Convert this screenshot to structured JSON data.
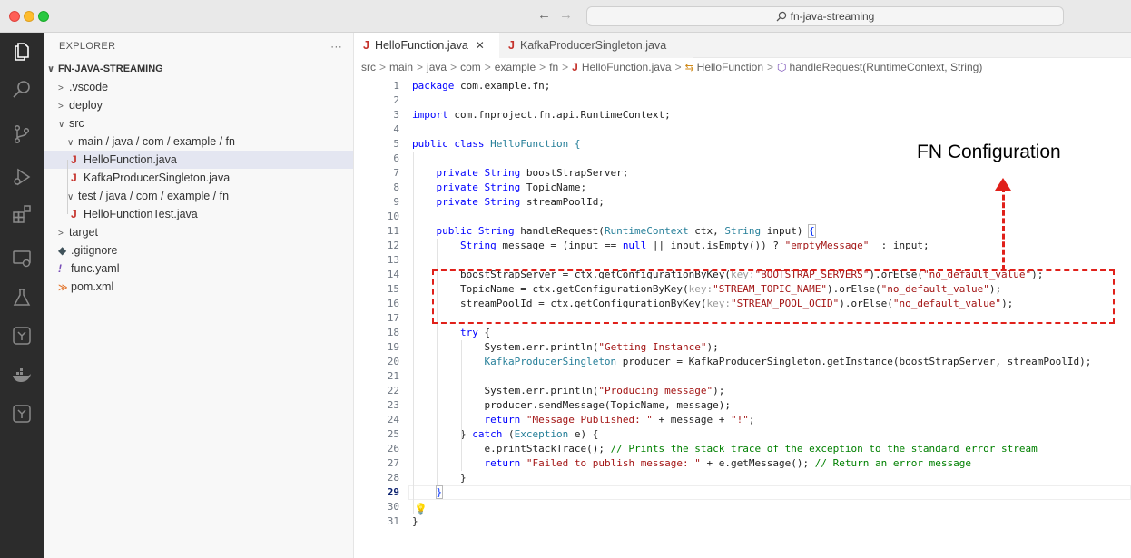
{
  "window": {
    "search_text": "fn-java-streaming"
  },
  "sidebar": {
    "header": "EXPLORER",
    "more": "···",
    "project": "FN-JAVA-STREAMING",
    "tree": {
      "vscode": ".vscode",
      "deploy": "deploy",
      "src": "src",
      "main_path": "main / java / com / example / fn",
      "hello_function": "HelloFunction.java",
      "kafka_producer": "KafkaProducerSingleton.java",
      "test_path": "test / java / com / example / fn",
      "hello_function_test": "HelloFunctionTest.java",
      "target": "target",
      "gitignore": ".gitignore",
      "func_yaml": "func.yaml",
      "pom_xml": "pom.xml"
    }
  },
  "editor": {
    "tabs": [
      {
        "label": "HelloFunction.java",
        "active": true
      },
      {
        "label": "KafkaProducerSingleton.java",
        "active": false
      }
    ],
    "breadcrumb": {
      "src": "src",
      "main": "main",
      "java": "java",
      "com": "com",
      "example": "example",
      "fn": "fn",
      "file": "HelloFunction.java",
      "class": "HelloFunction",
      "method": "handleRequest(RuntimeContext, String)"
    },
    "current_line": 29
  },
  "code": {
    "l1_a": "package",
    "l1_b": " com.example.fn;",
    "l3_a": "import",
    "l3_b": " com.fnproject.fn.api.RuntimeContext;",
    "l5_a": "public class",
    "l5_b": " HelloFunction {",
    "l7_a": "private String",
    "l7_b": " boostStrapServer;",
    "l8_a": "private String",
    "l8_b": " TopicName;",
    "l9_a": "private String",
    "l9_b": " streamPoolId;",
    "l11_a": "public String",
    "l11_b": " handleRequest(",
    "l11_c": "RuntimeContext",
    "l11_d": " ctx, ",
    "l11_e": "String",
    "l11_f": " input) ",
    "l11_g": "{",
    "l12_a": "String",
    "l12_b": " message = (input == ",
    "l12_c": "null",
    "l12_d": " || input.isEmpty()) ? ",
    "l12_e": "\"emptyMessage\"",
    "l12_f": "  : input;",
    "l14_a": "boostStrapServer = ctx.getConfigurationByKey(",
    "l14_b": "key:",
    "l14_c": "\"BOOTSTRAP_SERVERS\"",
    "l14_d": ").orElse(",
    "l14_e": "\"no_default_value\"",
    "l14_f": ");",
    "l15_a": "TopicName = ctx.getConfigurationByKey(",
    "l15_b": "key:",
    "l15_c": "\"STREAM_TOPIC_NAME\"",
    "l15_d": ").orElse(",
    "l15_e": "\"no_default_value\"",
    "l15_f": ");",
    "l16_a": "streamPoolId = ctx.getConfigurationByKey(",
    "l16_b": "key:",
    "l16_c": "\"STREAM_POOL_OCID\"",
    "l16_d": ").orElse(",
    "l16_e": "\"no_default_value\"",
    "l16_f": ");",
    "l18_a": "try",
    "l18_b": " {",
    "l19_a": "System.err.println(",
    "l19_b": "\"Getting Instance\"",
    "l19_c": ");",
    "l20_a": "KafkaProducerSingleton",
    "l20_b": " producer = KafkaProducerSingleton.getInstance(boostStrapServer, streamPoolId);",
    "l22_a": "System.err.println(",
    "l22_b": "\"Producing message\"",
    "l22_c": ");",
    "l23_a": "producer.sendMessage(TopicName, message);",
    "l24_a": "return",
    "l24_b": " ",
    "l24_c": "\"Message Published: \"",
    "l24_d": " + message + ",
    "l24_e": "\"!\"",
    "l24_f": ";",
    "l25_a": "} ",
    "l25_b": "catch",
    "l25_c": " (",
    "l25_d": "Exception",
    "l25_e": " e) {",
    "l26_a": "e.printStackTrace(); ",
    "l26_b": "// Prints the stack trace of the exception to the standard error stream",
    "l27_a": "return",
    "l27_b": " ",
    "l27_c": "\"Failed to publish message: \"",
    "l27_d": " + e.getMessage(); ",
    "l27_e": "// Return an error message",
    "l28_a": "}",
    "l29_a": "}",
    "l31_a": "}"
  },
  "annotation": {
    "label": "FN Configuration",
    "color": "#e0201a"
  }
}
